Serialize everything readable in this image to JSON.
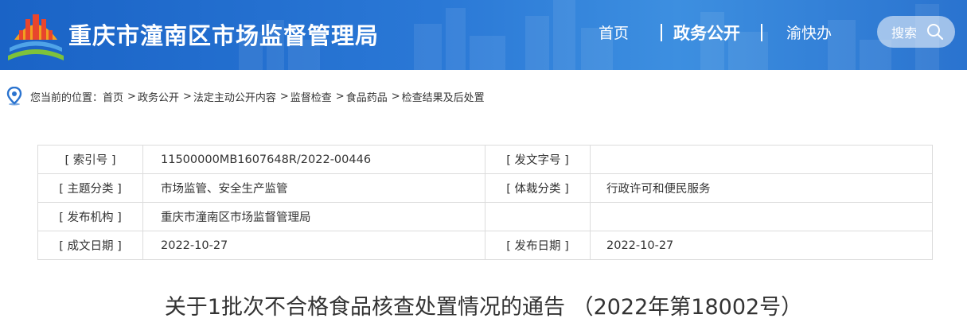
{
  "header": {
    "site_title": "重庆市潼南区市场监督管理局",
    "nav": {
      "home": "首页",
      "gov_open": "政务公开",
      "yukuaiban": "渝快办"
    },
    "search_label": "搜索"
  },
  "breadcrumb": {
    "prefix": "您当前的位置：",
    "items": [
      "首页",
      "政务公开",
      "法定主动公开内容",
      "监督检查",
      "食品药品",
      "检查结果及后处置"
    ],
    "separator": ">"
  },
  "info_table": {
    "rows": [
      {
        "k1": "[ 索引号 ]",
        "v1": "11500000MB1607648R/2022-00446",
        "k2": "[ 发文字号 ]",
        "v2": ""
      },
      {
        "k1": "[ 主题分类 ]",
        "v1": "市场监管、安全生产监管",
        "k2": "[ 体裁分类 ]",
        "v2": "行政许可和便民服务"
      },
      {
        "k1": "[ 发布机构 ]",
        "v1": "重庆市潼南区市场监督管理局",
        "k2": "",
        "v2": ""
      },
      {
        "k1": "[ 成文日期 ]",
        "v1": "2022-10-27",
        "k2": "[ 发布日期 ]",
        "v2": "2022-10-27"
      }
    ]
  },
  "document": {
    "title": "关于1批次不合格食品核查处置情况的通告 （2022年第18002号）"
  },
  "colors": {
    "header_blue": "#2a73cf",
    "logo_orange": "#f0a020",
    "logo_red": "#e8452c",
    "logo_green": "#7ec23a"
  }
}
